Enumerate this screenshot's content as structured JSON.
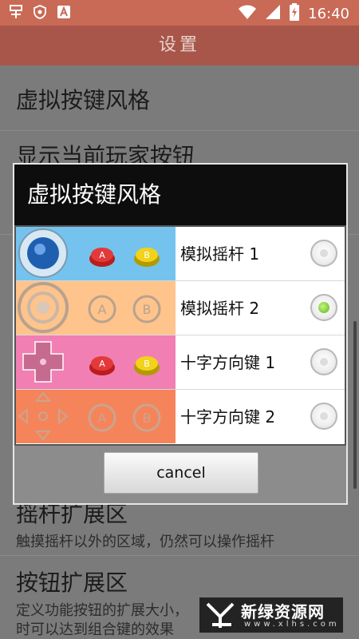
{
  "status_bar": {
    "time": "16:40",
    "icons": [
      "app-icon",
      "shield-icon",
      "a-badge-icon",
      "wifi-icon",
      "signal-icon",
      "battery-charging-icon"
    ]
  },
  "title": "设置",
  "settings": {
    "items": [
      {
        "title": "虚拟按键风格"
      },
      {
        "title": "显示当前玩家按钮"
      },
      {
        "title": "摇杆扩展区",
        "subtitle": "触摸摇杆以外的区域，仍然可以操作摇杆"
      },
      {
        "title": "按钮扩展区",
        "subtitle_line1": "定义功能按钮的扩展大小，",
        "subtitle_line2": "时可以达到组合键的效果"
      }
    ]
  },
  "dialog": {
    "title": "虚拟按键风格",
    "options": [
      {
        "label": "模拟摇杆 1",
        "selected": false,
        "color": "#74c3ee"
      },
      {
        "label": "模拟摇杆 2",
        "selected": true,
        "color": "#ffc38c"
      },
      {
        "label": "十字方向键 1",
        "selected": false,
        "color": "#f17fb4"
      },
      {
        "label": "十字方向键 2",
        "selected": false,
        "color": "#f6845b"
      }
    ],
    "cancel_label": "cancel"
  },
  "watermark": {
    "name": "新绿资源网",
    "url": "www.xlhs.com"
  },
  "colors": {
    "status_bar": "#c96a56",
    "title_bar": "#a8564a",
    "accent_radio": "#5db51a"
  }
}
